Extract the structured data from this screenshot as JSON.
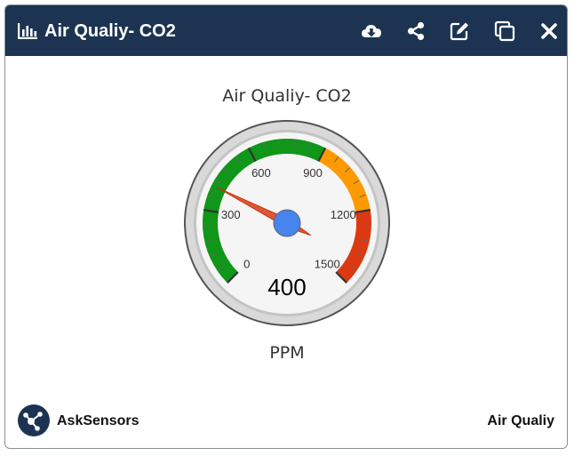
{
  "header": {
    "title": "Air Qualiy- CO2",
    "icons": [
      "bar-chart-icon",
      "cloud-download-icon",
      "share-icon",
      "edit-icon",
      "duplicate-icon",
      "close-icon"
    ]
  },
  "gauge": {
    "title": "Air Qualiy- CO2",
    "value": 400,
    "value_label": "400",
    "min": 0,
    "max": 1500,
    "tick_labels": [
      "0",
      "300",
      "600",
      "900",
      "1200",
      "1500"
    ],
    "unit": "PPM",
    "bands": [
      {
        "from": 0,
        "to": 900,
        "color": "#109618"
      },
      {
        "from": 900,
        "to": 1200,
        "color": "#ff9900"
      },
      {
        "from": 1200,
        "to": 1500,
        "color": "#dc3912"
      }
    ],
    "needle_color": "#dc3912",
    "hub_color": "#4684ee"
  },
  "footer": {
    "brand": "AskSensors",
    "sensor": "Air Qualiy"
  },
  "colors": {
    "header_bg": "#1c3452",
    "header_text": "#ffffff"
  }
}
